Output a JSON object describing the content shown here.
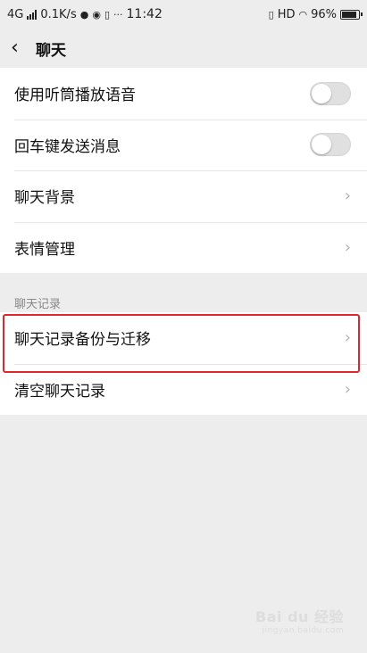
{
  "status": {
    "network": "4G",
    "speed": "0.1K/s",
    "time": "11:42",
    "hd": "HD",
    "battery": "96%",
    "battery_level": 0.96
  },
  "header": {
    "back_icon": "chevron-left-icon",
    "title": "聊天"
  },
  "settings": [
    {
      "label": "使用听筒播放语音",
      "control": "toggle",
      "on": false
    },
    {
      "label": "回车键发送消息",
      "control": "toggle",
      "on": false
    },
    {
      "label": "聊天背景",
      "control": "chevron"
    },
    {
      "label": "表情管理",
      "control": "chevron"
    }
  ],
  "history_section": {
    "label": "聊天记录",
    "items": [
      {
        "label": "聊天记录备份与迁移",
        "highlighted": true
      },
      {
        "label": "清空聊天记录"
      }
    ]
  },
  "colors": {
    "highlight": "#e0262a",
    "background": "#ededed",
    "toggle_off": "#e0e0e0"
  },
  "watermark": {
    "text": "Bai du 经验",
    "sub": "jingyan.baidu.com"
  }
}
